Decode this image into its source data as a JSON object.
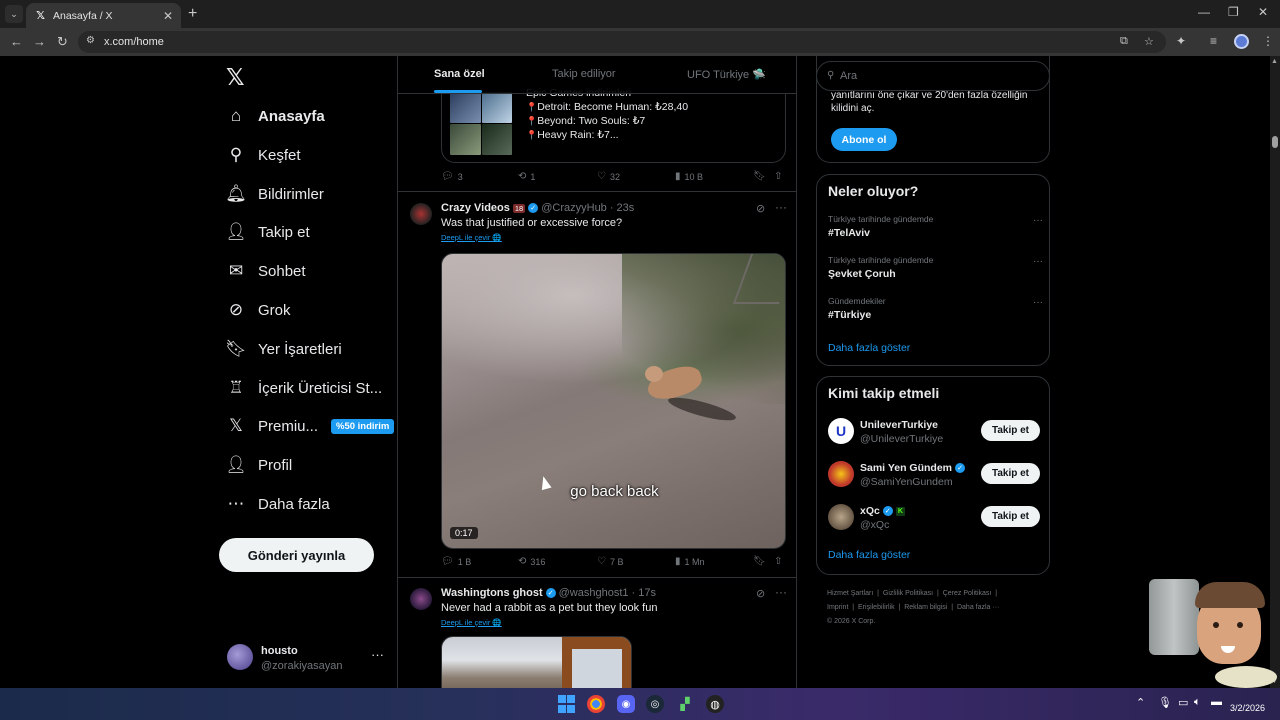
{
  "browser": {
    "tab_title": "Anasayfa / X",
    "tab_favicon": "x-logo-icon",
    "url": "x.com/home",
    "tab_search_glyph": "⌄",
    "icons": [
      "back-arrow-icon",
      "forward-arrow-icon",
      "reload-icon",
      "site-info-icon",
      "cast-icon",
      "bookmark-star-icon",
      "extensions-icon",
      "media-control-icon",
      "profile-icon",
      "menu-icon"
    ]
  },
  "nav": {
    "logo": "𝕏",
    "items": [
      {
        "label": "Anasayfa",
        "icon": "home-icon",
        "glyph": "⌂"
      },
      {
        "label": "Keşfet",
        "icon": "search-icon",
        "glyph": "⚲"
      },
      {
        "label": "Bildirimler",
        "icon": "bell-icon",
        "glyph": "🔔︎"
      },
      {
        "label": "Takip et",
        "icon": "add-person-icon",
        "glyph": "👤︎"
      },
      {
        "label": "Sohbet",
        "icon": "mail-icon",
        "glyph": "✉"
      },
      {
        "label": "Grok",
        "icon": "grok-icon",
        "glyph": "⊘"
      },
      {
        "label": "Yer İşaretleri",
        "icon": "bookmark-icon",
        "glyph": "🔖︎"
      },
      {
        "label": "İçerik Üreticisi St...",
        "icon": "creator-studio-icon",
        "glyph": "♖"
      },
      {
        "label": "Premiu...",
        "icon": "premium-x-icon",
        "glyph": "𝕏",
        "promo": "%50 indirim"
      },
      {
        "label": "Profil",
        "icon": "person-icon",
        "glyph": "👤︎"
      },
      {
        "label": "Daha fazla",
        "icon": "more-circle-icon",
        "glyph": "⋯"
      }
    ],
    "post_button": "Gönderi yayınla",
    "account": {
      "name": "housto",
      "handle": "@zorakiyasayan",
      "more": "···"
    }
  },
  "feed": {
    "tabs": [
      "Sana özel",
      "Takip ediliyor",
      "UFO Türkiye 🛸"
    ],
    "posts": [
      {
        "card_lines": [
          "Epic Games indirimleri",
          "Detroit: Become Human: ₺28,40",
          "Beyond: Two Souls: ₺7",
          "Heavy Rain: ₺7..."
        ],
        "replies": "3",
        "reposts": "1",
        "likes": "32",
        "views": "10 B"
      },
      {
        "name": "Crazy Videos",
        "age_badge": "18",
        "handle": "@CrazyyHub",
        "time": "· 23s",
        "text": "Was that justified or excessive force?",
        "translate": "DeepL ile çevir 🌐",
        "video_caption": "go back back",
        "video_duration": "0:17",
        "replies": "1 B",
        "reposts": "316",
        "likes": "7 B",
        "views": "1 Mn"
      },
      {
        "name": "Washingtons ghost",
        "handle": "@washghost1",
        "time": "· 17s",
        "text": "Never had a rabbit as a pet but they look fun",
        "translate": "DeepL ile çevir 🌐"
      }
    ]
  },
  "sidebar": {
    "search_placeholder": "Ara",
    "premium": {
      "desc": "yanıtlarını öne çıkar ve 20'den fazla özelliğin kilidini aç.",
      "button": "Abone ol"
    },
    "trends_title": "Neler oluyor?",
    "trends": [
      {
        "context": "Türkiye tarihinde gündemde",
        "topic": "#TelAviv"
      },
      {
        "context": "Türkiye tarihinde gündemde",
        "topic": "Şevket Çoruh"
      },
      {
        "context": "Gündemdekiler",
        "topic": "#Türkiye"
      }
    ],
    "trends_more": "Daha fazla göster",
    "who_title": "Kimi takip etmeli",
    "who": [
      {
        "name": "UnileverTurkiye",
        "handle": "@UnileverTurkiye",
        "button": "Takip et",
        "verified": false
      },
      {
        "name": "Sami Yen Gündem",
        "handle": "@SamiYenGundem",
        "button": "Takip et",
        "verified": true
      },
      {
        "name": "xQc",
        "handle": "@xQc",
        "button": "Takip et",
        "verified": true,
        "kick": "K"
      }
    ],
    "who_more": "Daha fazla göster",
    "footer": [
      "Hizmet Şartları",
      "Gizlilik Politikası",
      "Çerez Politikası",
      "Imprint",
      "Erişilebilirlik",
      "Reklam bilgisi",
      "Daha fazla ···",
      "© 2026 X Corp."
    ]
  },
  "taskbar": {
    "date": "3/2/2026",
    "icons": [
      "windows-start-icon",
      "chrome-icon",
      "discord-icon",
      "steam-icon",
      "app-icon",
      "obs-icon"
    ],
    "tray_icons": [
      "chevron-up-icon",
      "microphone-icon",
      "network-icon",
      "volume-icon",
      "battery-icon"
    ]
  },
  "colors": {
    "accent": "#1d9bf0",
    "background": "#000000",
    "text": "#e7e9ea",
    "muted": "#71767b",
    "border": "#2f3336"
  }
}
